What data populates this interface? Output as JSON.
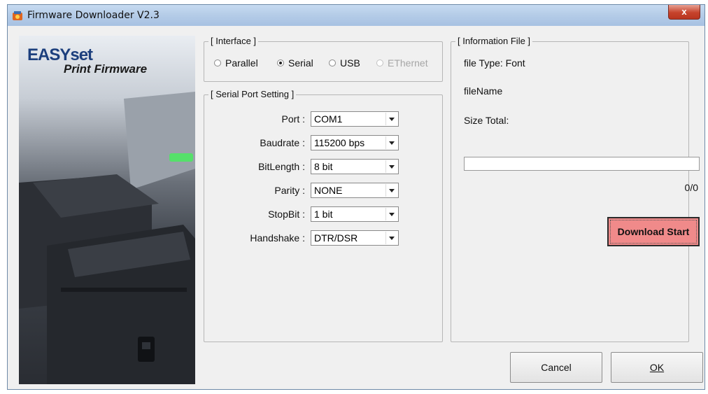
{
  "window": {
    "title": "Firmware Downloader  V2.3",
    "close_label": "x"
  },
  "side_panel": {
    "logo_main": "EASYset",
    "logo_sub": "Print Firmware"
  },
  "interface": {
    "legend": "[ Interface ]",
    "options": [
      {
        "label": "Parallel",
        "selected": false,
        "enabled": true
      },
      {
        "label": "Serial",
        "selected": true,
        "enabled": true
      },
      {
        "label": "USB",
        "selected": false,
        "enabled": true
      },
      {
        "label": "EThernet",
        "selected": false,
        "enabled": false
      }
    ]
  },
  "serial": {
    "legend": "[ Serial Port Setting ]",
    "rows": [
      {
        "label": "Port :",
        "value": "COM1"
      },
      {
        "label": "Baudrate :",
        "value": "115200 bps"
      },
      {
        "label": "BitLength :",
        "value": "8 bit"
      },
      {
        "label": "Parity :",
        "value": "NONE"
      },
      {
        "label": "StopBit :",
        "value": "1 bit"
      },
      {
        "label": "Handshake :",
        "value": "DTR/DSR"
      }
    ]
  },
  "info": {
    "legend": "[ Information File ]",
    "file_type": "file Type: Font",
    "file_name": "fileName",
    "size_total": "Size Total:",
    "progress_fraction": 0,
    "progress_text": "0/0",
    "download_label": "Download Start"
  },
  "buttons": {
    "cancel": "Cancel",
    "ok": "OK"
  },
  "colors": {
    "download_button": "#f08a8a",
    "title_bar": "#b6cde8",
    "close_button": "#c6432c"
  }
}
